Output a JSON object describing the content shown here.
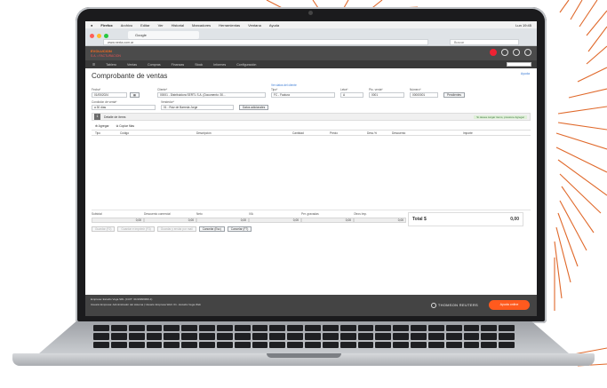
{
  "colors": {
    "accent": "#ff5a1e",
    "menubar": "#f2f2f2",
    "appbar": "#4b4b4b",
    "deco": "#e0692b"
  },
  "menubar": {
    "items": [
      "Firefox",
      "Archivo",
      "Editar",
      "Ver",
      "Historial",
      "Marcadores",
      "Herramientas",
      "Ventana",
      "Ayuda"
    ],
    "clock": "Lun 19:45"
  },
  "browser": {
    "tab": "Google",
    "address": "www.nexta.com.ar",
    "search": "Buscar"
  },
  "app": {
    "brand": "EVOLUCION",
    "subbrand": "S.A. • FACTURACION",
    "tools": [
      "bell-icon",
      "help-icon",
      "user-icon",
      "settings-icon"
    ]
  },
  "subnav": [
    "Tablero",
    "Ventas",
    "Compras",
    "Finanzas",
    "Stock",
    "Informes",
    "Configuración"
  ],
  "page": {
    "title": "Comprobante de ventas",
    "help": "Ayuda"
  },
  "form": {
    "fecha_label": "Fecha*",
    "fecha": "01/05/2024",
    "cliente_label": "Cliente*",
    "cliente": "00001 - Distribuidora SERTL S.A. (Documento: 30...",
    "ver_datos": "Ver datos del cliente",
    "tipo_label": "Tipo*",
    "tipo": "FC - Factura",
    "letra_label": "Letra*",
    "letra": "A",
    "pto_label": "Pto. venta*",
    "pto": "0001",
    "numero_label": "Número*",
    "numero": "00000001",
    "pendientes": "Pendientes",
    "condicion_label": "Condición de venta*",
    "condicion": "a 30 días",
    "vendedor_label": "Vendedor*",
    "vendedor": "01 - Ruiz de Barreda Jorge",
    "otros": "Datos adicionales"
  },
  "band": {
    "num": "1",
    "label": "Detalle de ítems",
    "note": "Si desea cargar ítems, presione Agregar"
  },
  "actions": {
    "agregar": "Agregar",
    "copiar": "Copiar filas"
  },
  "table": {
    "headers": [
      "Tipo",
      "Código",
      "Descripción",
      "Cantidad",
      "Precio",
      "Desc.%",
      "Descuento",
      "Importe"
    ]
  },
  "totals": {
    "labels": [
      "Subtotal",
      "Descuento comercial",
      "Neto",
      "IVA",
      "Per. gravadas",
      "Otros Imp."
    ],
    "values": [
      "0,00",
      "0,00",
      "0,00",
      "0,00",
      "0,00",
      "0,00"
    ],
    "total_label": "Total $",
    "total_value": "0,00"
  },
  "buttons": [
    "Guardar (F2)",
    "Guardar e imprimir (F3)",
    "Guardar y enviar por mail",
    "Cancelar (Esc)",
    "Cancelar (F7)"
  ],
  "footer": {
    "line1": "Empresa: Estudio Vega SRL (CUIT: 30-99999999-1)",
    "line2": "Usuario Empresa: Administrador del sistema | Usuario Empresa Web: 01 - Estudio Vega Web",
    "brand": "THOMSON REUTERS",
    "help": "Ayuda online"
  }
}
